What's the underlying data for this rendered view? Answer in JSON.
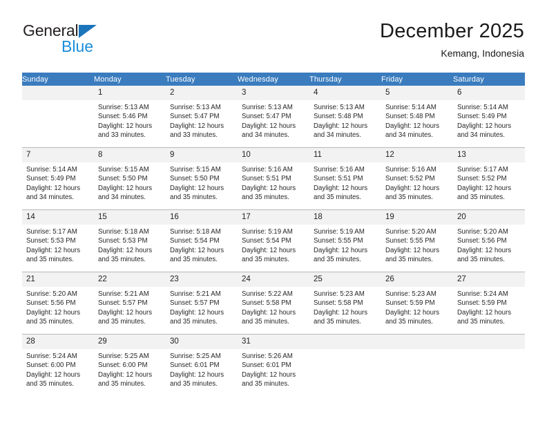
{
  "brand": {
    "name_part1": "General",
    "name_part2": "Blue",
    "triangle_color": "#1b75bb",
    "blue_text_color": "#1b8ddb"
  },
  "header": {
    "title": "December 2025",
    "location": "Kemang, Indonesia"
  },
  "colors": {
    "header_row_background": "#3a7cbe",
    "header_row_text": "#ffffff",
    "daynumber_background": "#f2f2f2",
    "grid_line": "#b8b8b8",
    "page_background": "#ffffff"
  },
  "weekdays": [
    "Sunday",
    "Monday",
    "Tuesday",
    "Wednesday",
    "Thursday",
    "Friday",
    "Saturday"
  ],
  "weeks": [
    [
      {
        "day": "",
        "sunrise": "",
        "sunset": "",
        "daylight_line1": "",
        "daylight_line2": "",
        "empty": true
      },
      {
        "day": "1",
        "sunrise": "Sunrise: 5:13 AM",
        "sunset": "Sunset: 5:46 PM",
        "daylight_line1": "Daylight: 12 hours",
        "daylight_line2": "and 33 minutes."
      },
      {
        "day": "2",
        "sunrise": "Sunrise: 5:13 AM",
        "sunset": "Sunset: 5:47 PM",
        "daylight_line1": "Daylight: 12 hours",
        "daylight_line2": "and 33 minutes."
      },
      {
        "day": "3",
        "sunrise": "Sunrise: 5:13 AM",
        "sunset": "Sunset: 5:47 PM",
        "daylight_line1": "Daylight: 12 hours",
        "daylight_line2": "and 34 minutes."
      },
      {
        "day": "4",
        "sunrise": "Sunrise: 5:13 AM",
        "sunset": "Sunset: 5:48 PM",
        "daylight_line1": "Daylight: 12 hours",
        "daylight_line2": "and 34 minutes."
      },
      {
        "day": "5",
        "sunrise": "Sunrise: 5:14 AM",
        "sunset": "Sunset: 5:48 PM",
        "daylight_line1": "Daylight: 12 hours",
        "daylight_line2": "and 34 minutes."
      },
      {
        "day": "6",
        "sunrise": "Sunrise: 5:14 AM",
        "sunset": "Sunset: 5:49 PM",
        "daylight_line1": "Daylight: 12 hours",
        "daylight_line2": "and 34 minutes."
      }
    ],
    [
      {
        "day": "7",
        "sunrise": "Sunrise: 5:14 AM",
        "sunset": "Sunset: 5:49 PM",
        "daylight_line1": "Daylight: 12 hours",
        "daylight_line2": "and 34 minutes."
      },
      {
        "day": "8",
        "sunrise": "Sunrise: 5:15 AM",
        "sunset": "Sunset: 5:50 PM",
        "daylight_line1": "Daylight: 12 hours",
        "daylight_line2": "and 34 minutes."
      },
      {
        "day": "9",
        "sunrise": "Sunrise: 5:15 AM",
        "sunset": "Sunset: 5:50 PM",
        "daylight_line1": "Daylight: 12 hours",
        "daylight_line2": "and 35 minutes."
      },
      {
        "day": "10",
        "sunrise": "Sunrise: 5:16 AM",
        "sunset": "Sunset: 5:51 PM",
        "daylight_line1": "Daylight: 12 hours",
        "daylight_line2": "and 35 minutes."
      },
      {
        "day": "11",
        "sunrise": "Sunrise: 5:16 AM",
        "sunset": "Sunset: 5:51 PM",
        "daylight_line1": "Daylight: 12 hours",
        "daylight_line2": "and 35 minutes."
      },
      {
        "day": "12",
        "sunrise": "Sunrise: 5:16 AM",
        "sunset": "Sunset: 5:52 PM",
        "daylight_line1": "Daylight: 12 hours",
        "daylight_line2": "and 35 minutes."
      },
      {
        "day": "13",
        "sunrise": "Sunrise: 5:17 AM",
        "sunset": "Sunset: 5:52 PM",
        "daylight_line1": "Daylight: 12 hours",
        "daylight_line2": "and 35 minutes."
      }
    ],
    [
      {
        "day": "14",
        "sunrise": "Sunrise: 5:17 AM",
        "sunset": "Sunset: 5:53 PM",
        "daylight_line1": "Daylight: 12 hours",
        "daylight_line2": "and 35 minutes."
      },
      {
        "day": "15",
        "sunrise": "Sunrise: 5:18 AM",
        "sunset": "Sunset: 5:53 PM",
        "daylight_line1": "Daylight: 12 hours",
        "daylight_line2": "and 35 minutes."
      },
      {
        "day": "16",
        "sunrise": "Sunrise: 5:18 AM",
        "sunset": "Sunset: 5:54 PM",
        "daylight_line1": "Daylight: 12 hours",
        "daylight_line2": "and 35 minutes."
      },
      {
        "day": "17",
        "sunrise": "Sunrise: 5:19 AM",
        "sunset": "Sunset: 5:54 PM",
        "daylight_line1": "Daylight: 12 hours",
        "daylight_line2": "and 35 minutes."
      },
      {
        "day": "18",
        "sunrise": "Sunrise: 5:19 AM",
        "sunset": "Sunset: 5:55 PM",
        "daylight_line1": "Daylight: 12 hours",
        "daylight_line2": "and 35 minutes."
      },
      {
        "day": "19",
        "sunrise": "Sunrise: 5:20 AM",
        "sunset": "Sunset: 5:55 PM",
        "daylight_line1": "Daylight: 12 hours",
        "daylight_line2": "and 35 minutes."
      },
      {
        "day": "20",
        "sunrise": "Sunrise: 5:20 AM",
        "sunset": "Sunset: 5:56 PM",
        "daylight_line1": "Daylight: 12 hours",
        "daylight_line2": "and 35 minutes."
      }
    ],
    [
      {
        "day": "21",
        "sunrise": "Sunrise: 5:20 AM",
        "sunset": "Sunset: 5:56 PM",
        "daylight_line1": "Daylight: 12 hours",
        "daylight_line2": "and 35 minutes."
      },
      {
        "day": "22",
        "sunrise": "Sunrise: 5:21 AM",
        "sunset": "Sunset: 5:57 PM",
        "daylight_line1": "Daylight: 12 hours",
        "daylight_line2": "and 35 minutes."
      },
      {
        "day": "23",
        "sunrise": "Sunrise: 5:21 AM",
        "sunset": "Sunset: 5:57 PM",
        "daylight_line1": "Daylight: 12 hours",
        "daylight_line2": "and 35 minutes."
      },
      {
        "day": "24",
        "sunrise": "Sunrise: 5:22 AM",
        "sunset": "Sunset: 5:58 PM",
        "daylight_line1": "Daylight: 12 hours",
        "daylight_line2": "and 35 minutes."
      },
      {
        "day": "25",
        "sunrise": "Sunrise: 5:23 AM",
        "sunset": "Sunset: 5:58 PM",
        "daylight_line1": "Daylight: 12 hours",
        "daylight_line2": "and 35 minutes."
      },
      {
        "day": "26",
        "sunrise": "Sunrise: 5:23 AM",
        "sunset": "Sunset: 5:59 PM",
        "daylight_line1": "Daylight: 12 hours",
        "daylight_line2": "and 35 minutes."
      },
      {
        "day": "27",
        "sunrise": "Sunrise: 5:24 AM",
        "sunset": "Sunset: 5:59 PM",
        "daylight_line1": "Daylight: 12 hours",
        "daylight_line2": "and 35 minutes."
      }
    ],
    [
      {
        "day": "28",
        "sunrise": "Sunrise: 5:24 AM",
        "sunset": "Sunset: 6:00 PM",
        "daylight_line1": "Daylight: 12 hours",
        "daylight_line2": "and 35 minutes."
      },
      {
        "day": "29",
        "sunrise": "Sunrise: 5:25 AM",
        "sunset": "Sunset: 6:00 PM",
        "daylight_line1": "Daylight: 12 hours",
        "daylight_line2": "and 35 minutes."
      },
      {
        "day": "30",
        "sunrise": "Sunrise: 5:25 AM",
        "sunset": "Sunset: 6:01 PM",
        "daylight_line1": "Daylight: 12 hours",
        "daylight_line2": "and 35 minutes."
      },
      {
        "day": "31",
        "sunrise": "Sunrise: 5:26 AM",
        "sunset": "Sunset: 6:01 PM",
        "daylight_line1": "Daylight: 12 hours",
        "daylight_line2": "and 35 minutes."
      },
      {
        "day": "",
        "sunrise": "",
        "sunset": "",
        "daylight_line1": "",
        "daylight_line2": "",
        "empty": true
      },
      {
        "day": "",
        "sunrise": "",
        "sunset": "",
        "daylight_line1": "",
        "daylight_line2": "",
        "empty": true
      },
      {
        "day": "",
        "sunrise": "",
        "sunset": "",
        "daylight_line1": "",
        "daylight_line2": "",
        "empty": true
      }
    ]
  ]
}
